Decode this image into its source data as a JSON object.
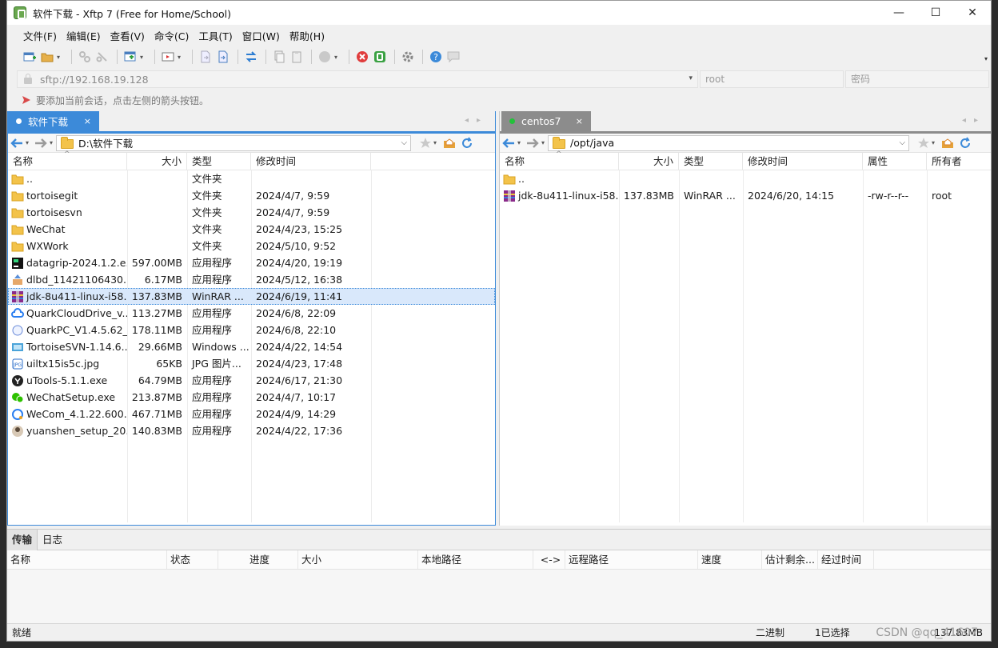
{
  "window": {
    "title": "软件下载 - Xftp 7 (Free for Home/School)",
    "controls": {
      "minimize": "—",
      "maximize": "☐",
      "close": "✕"
    }
  },
  "menu": [
    "文件(F)",
    "编辑(E)",
    "查看(V)",
    "命令(C)",
    "工具(T)",
    "窗口(W)",
    "帮助(H)"
  ],
  "address": {
    "url": "sftp://192.168.19.128",
    "user_placeholder": "root",
    "password_placeholder": "密码"
  },
  "hint": "要添加当前会话，点击左侧的箭头按钮。",
  "left_pane": {
    "tab_label": "软件下载",
    "tab_close": "×",
    "path": "D:\\软件下载",
    "columns": [
      "名称",
      "大小",
      "类型",
      "修改时间"
    ],
    "rows": [
      {
        "name": "..",
        "size": "",
        "type": "文件夹",
        "mtime": "",
        "icon": "folder-icon"
      },
      {
        "name": "tortoisegit",
        "size": "",
        "type": "文件夹",
        "mtime": "2024/4/7, 9:59",
        "icon": "folder-icon"
      },
      {
        "name": "tortoisesvn",
        "size": "",
        "type": "文件夹",
        "mtime": "2024/4/7, 9:59",
        "icon": "folder-icon"
      },
      {
        "name": "WeChat",
        "size": "",
        "type": "文件夹",
        "mtime": "2024/4/23, 15:25",
        "icon": "folder-icon"
      },
      {
        "name": "WXWork",
        "size": "",
        "type": "文件夹",
        "mtime": "2024/5/10, 9:52",
        "icon": "folder-icon"
      },
      {
        "name": "datagrip-2024.1.2.e...",
        "size": "597.00MB",
        "type": "应用程序",
        "mtime": "2024/4/20, 19:19",
        "icon": "datagrip-icon"
      },
      {
        "name": "dlbd_11421106430...",
        "size": "6.17MB",
        "type": "应用程序",
        "mtime": "2024/5/12, 16:38",
        "icon": "installer-icon"
      },
      {
        "name": "jdk-8u411-linux-i58...",
        "size": "137.83MB",
        "type": "WinRAR ...",
        "mtime": "2024/6/19, 11:41",
        "icon": "winrar-icon",
        "selected": true
      },
      {
        "name": "QuarkCloudDrive_v...",
        "size": "113.27MB",
        "type": "应用程序",
        "mtime": "2024/6/8, 22:09",
        "icon": "quark-cloud-icon"
      },
      {
        "name": "QuarkPC_V1.4.5.62_...",
        "size": "178.11MB",
        "type": "应用程序",
        "mtime": "2024/6/8, 22:10",
        "icon": "quark-pc-icon"
      },
      {
        "name": "TortoiseSVN-1.14.6....",
        "size": "29.66MB",
        "type": "Windows ...",
        "mtime": "2024/4/22, 14:54",
        "icon": "msi-icon"
      },
      {
        "name": "uiltx15is5c.jpg",
        "size": "65KB",
        "type": "JPG 图片...",
        "mtime": "2024/4/23, 17:48",
        "icon": "jpg-icon"
      },
      {
        "name": "uTools-5.1.1.exe",
        "size": "64.79MB",
        "type": "应用程序",
        "mtime": "2024/6/17, 21:30",
        "icon": "utools-icon"
      },
      {
        "name": "WeChatSetup.exe",
        "size": "213.87MB",
        "type": "应用程序",
        "mtime": "2024/4/7, 10:17",
        "icon": "wechat-icon"
      },
      {
        "name": "WeCom_4.1.22.600...",
        "size": "467.71MB",
        "type": "应用程序",
        "mtime": "2024/4/9, 14:29",
        "icon": "wecom-icon"
      },
      {
        "name": "yuanshen_setup_20...",
        "size": "140.83MB",
        "type": "应用程序",
        "mtime": "2024/4/22, 17:36",
        "icon": "yuanshen-icon"
      }
    ]
  },
  "right_pane": {
    "tab_label": "centos7",
    "tab_close": "×",
    "path": "/opt/java",
    "columns": [
      "名称",
      "大小",
      "类型",
      "修改时间",
      "属性",
      "所有者"
    ],
    "rows": [
      {
        "name": "..",
        "size": "",
        "type": "",
        "mtime": "",
        "attr": "",
        "owner": "",
        "icon": "folder-icon"
      },
      {
        "name": "jdk-8u411-linux-i58...",
        "size": "137.83MB",
        "type": "WinRAR ...",
        "mtime": "2024/6/20, 14:15",
        "attr": "-rw-r--r--",
        "owner": "root",
        "icon": "winrar-icon"
      }
    ]
  },
  "transfer": {
    "tabs": [
      "传输",
      "日志"
    ],
    "columns": [
      "名称",
      "状态",
      "进度",
      "大小",
      "本地路径",
      "<->",
      "远程路径",
      "速度",
      "估计剩余...",
      "经过时间"
    ]
  },
  "status": {
    "left": "就绪",
    "mode": "二进制",
    "selection": "1已选择",
    "size": "137.83MB"
  },
  "watermark": "CSDN @qq_41607"
}
